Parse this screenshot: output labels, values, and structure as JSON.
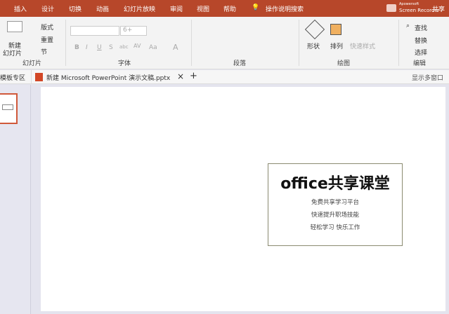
{
  "tabs": [
    "插入",
    "设计",
    "切换",
    "动画",
    "幻灯片放映",
    "审阅",
    "视图",
    "帮助",
    "操作说明搜索"
  ],
  "recorder": {
    "line1": "Apowersoft",
    "line2": "Screen Recorder"
  },
  "share": "共享",
  "ribbon": {
    "slides": {
      "new_slide": "新建",
      "new_slide2": "幻灯片",
      "layout": "版式",
      "reset": "重置",
      "section": "节",
      "group": "幻灯片"
    },
    "font": {
      "size": "6+",
      "group": "字体",
      "bold": "B",
      "italic": "I",
      "underline": "U",
      "strike": "S",
      "abc": "abc",
      "spacing": "AV",
      "case": "Aa",
      "color": "A"
    },
    "paragraph": {
      "group": "段落"
    },
    "drawing": {
      "shapes": "形状",
      "arrange": "排列",
      "quick_styles": "快速样式",
      "group": "绘图"
    },
    "editing": {
      "find": "查找",
      "replace": "替换",
      "select": "选择",
      "group": "编辑"
    }
  },
  "doctabs": {
    "left": "模板专区",
    "file": "新建 Microsoft PowerPoint 演示文稿.pptx",
    "close": "×",
    "add": "+",
    "multi": "显示多窗口"
  },
  "slide": {
    "title": "office共享课堂",
    "lines": [
      "免费共享学习平台",
      "快速提升职场技能",
      "轻松学习 快乐工作"
    ]
  }
}
